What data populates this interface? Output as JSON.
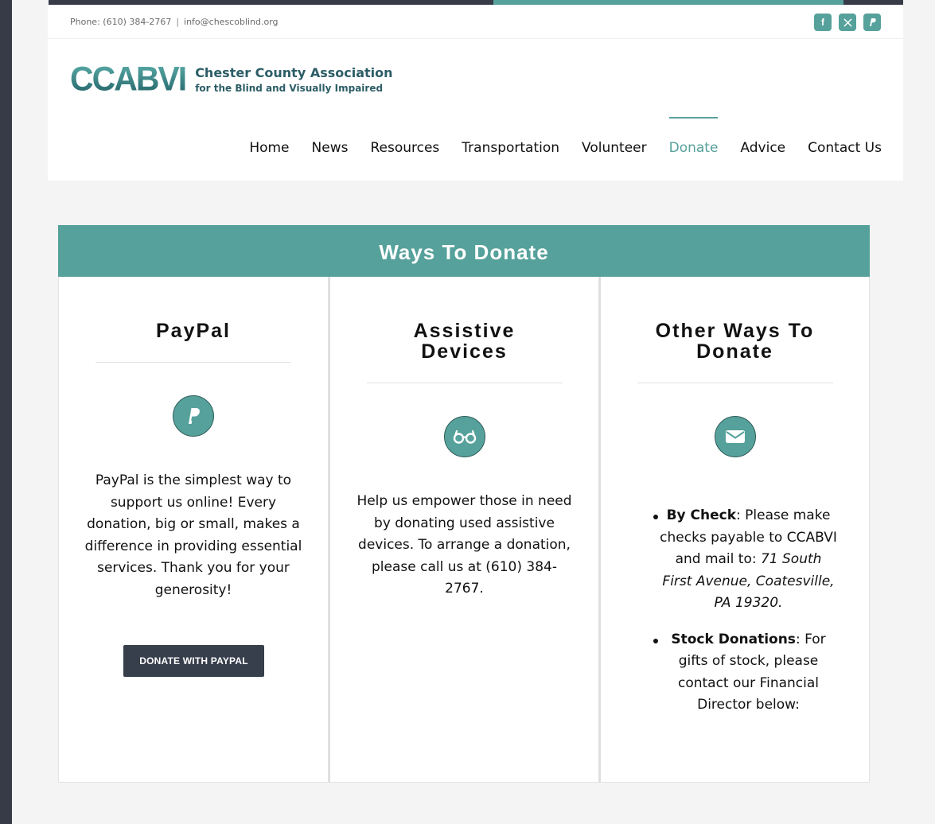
{
  "topbar": {
    "phone": "Phone: (610) 384-2767",
    "separator": "|",
    "email": "info@chescoblind.org",
    "socials": [
      {
        "icon": "facebook-icon",
        "glyph": "f"
      },
      {
        "icon": "x-twitter-icon",
        "glyph": "𝕏"
      },
      {
        "icon": "paypal-icon",
        "glyph": "P"
      }
    ]
  },
  "logo": {
    "mark": "CCABVI",
    "line1": "Chester County Association",
    "line2": "for the Blind and Visually Impaired"
  },
  "nav": {
    "items": [
      "Home",
      "News",
      "Resources",
      "Transportation",
      "Volunteer",
      "Donate",
      "Advice",
      "Contact Us"
    ],
    "active": "Donate"
  },
  "banner": {
    "title": "Ways To Donate"
  },
  "columns": {
    "paypal": {
      "title": "PayPal",
      "icon": "paypal-icon",
      "body": "PayPal is the simplest way to support us online! Every donation, big or small, makes a difference in providing essential services. Thank you for your generosity!",
      "button": "DONATE WITH PAYPAL"
    },
    "assistive": {
      "title_line1": "Assistive",
      "title_line2": "Devices",
      "icon": "glasses-icon",
      "body": "Help us empower those in need by donating used assistive devices. To arrange a donation, please call us at (610) 384-2767."
    },
    "other": {
      "title_line1": "Other Ways To",
      "title_line2": "Donate",
      "icon": "envelope-icon",
      "check_label": "By Check",
      "check_text": ": Please make checks payable to CCABVI and mail to: ",
      "check_address": "71 South First Avenue, Coatesville, PA 19320.",
      "stock_label": "Stock Donations",
      "stock_text": ": For gifts of stock, please contact our Financial Director below:"
    }
  },
  "colors": {
    "accent": "#56a19b",
    "dark": "#373b47",
    "button": "#373e4c"
  }
}
